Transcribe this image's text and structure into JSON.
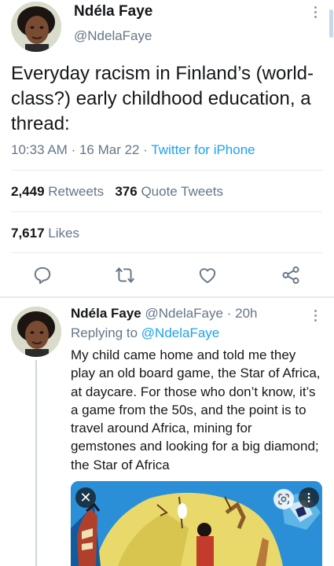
{
  "colors": {
    "text": "#14171a",
    "secondary": "#657786",
    "link": "#1da1f2",
    "divider": "#e6ecf0",
    "icon": "#657786"
  },
  "tweet": {
    "author_name": "Ndéla Faye",
    "author_handle": "@NdelaFaye",
    "text": "Everyday racism in Finland’s (world-class?) early childhood education, a thread:",
    "time": "10:33 AM",
    "date": "16 Mar 22",
    "separator": "·",
    "source": "Twitter for iPhone",
    "retweets_count": "2,449",
    "retweets_label": "Retweets",
    "quotes_count": "376",
    "quotes_label": "Quote Tweets",
    "likes_count": "7,617",
    "likes_label": "Likes",
    "more_icon": "more-vertical-icon"
  },
  "actions": [
    {
      "name": "reply",
      "icon": "reply-icon"
    },
    {
      "name": "retweet",
      "icon": "retweet-icon"
    },
    {
      "name": "like",
      "icon": "heart-icon"
    },
    {
      "name": "share",
      "icon": "share-icon"
    }
  ],
  "reply": {
    "author_name": "Ndéla Faye",
    "author_handle": "@NdelaFaye",
    "separator": "·",
    "age": "20h",
    "replying_prefix": "Replying to",
    "replying_to": "@NdelaFaye",
    "text": "My child came home and told me they play an old board game, the Star of Africa, at daycare. For those who don’t know, it’s a game from the 50s, and the point is to travel around Africa, mining for gemstones and looking for a big diamond; the Star of Africa"
  },
  "media": {
    "close_symbol": "✕",
    "more_icon": "more-vertical-icon",
    "lens_icon": "google-lens-icon"
  }
}
